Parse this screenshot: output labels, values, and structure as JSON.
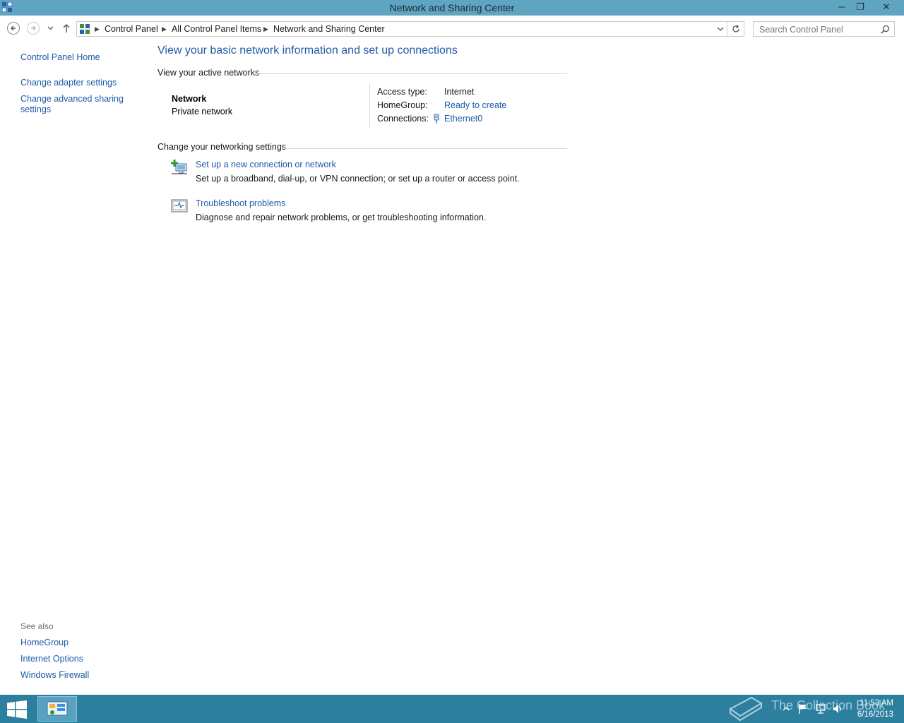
{
  "window": {
    "title": "Network and Sharing Center"
  },
  "titlebar_buttons": {
    "minimize": "─",
    "restore": "❐",
    "close": "✕"
  },
  "navigation": {
    "back_icon": "back-arrow-icon",
    "forward_icon": "forward-arrow-icon",
    "recent_icon": "chevron-down-icon",
    "up_icon": "up-arrow-icon"
  },
  "breadcrumb": {
    "items": [
      "Control Panel",
      "All Control Panel Items",
      "Network and Sharing Center"
    ]
  },
  "search": {
    "placeholder": "Search Control Panel"
  },
  "sidebar": {
    "home": "Control Panel Home",
    "links": [
      "Change adapter settings",
      "Change advanced sharing settings"
    ],
    "see_also_heading": "See also",
    "see_also": [
      "HomeGroup",
      "Internet Options",
      "Windows Firewall"
    ]
  },
  "main": {
    "heading": "View your basic network information and set up connections",
    "active_networks_heading": "View your active networks",
    "network": {
      "name": "Network",
      "type": "Private network",
      "access_type_label": "Access type:",
      "access_type_value": "Internet",
      "homegroup_label": "HomeGroup:",
      "homegroup_value": "Ready to create",
      "connections_label": "Connections:",
      "connections_value": "Ethernet0"
    },
    "change_settings_heading": "Change your networking settings",
    "tasks": [
      {
        "title": "Set up a new connection or network",
        "description": "Set up a broadband, dial-up, or VPN connection; or set up a router or access point.",
        "icon": "new-connection-icon"
      },
      {
        "title": "Troubleshoot problems",
        "description": "Diagnose and repair network problems, or get troubleshooting information.",
        "icon": "troubleshoot-icon"
      }
    ]
  },
  "taskbar": {
    "time": "11:53 AM",
    "date": "6/16/2013",
    "watermark": "The Collection Book"
  }
}
